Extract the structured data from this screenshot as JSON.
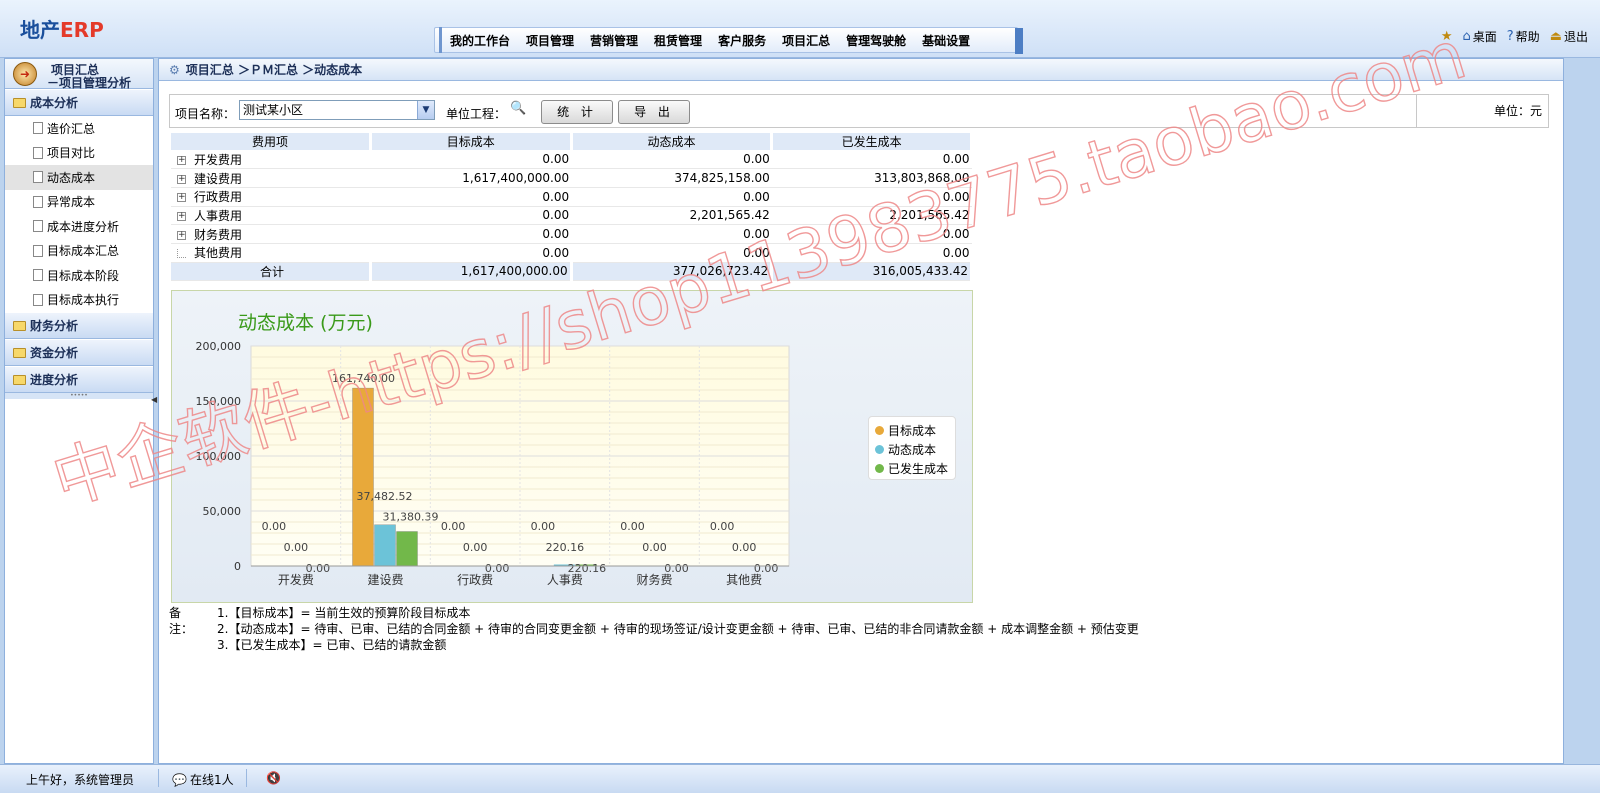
{
  "header": {
    "logo_a": "地产",
    "logo_b": "ERP",
    "nav": [
      "我的工作台",
      "项目管理",
      "营销管理",
      "租赁管理",
      "客户服务",
      "项目汇总",
      "管理驾驶舱",
      "基础设置"
    ],
    "tools": {
      "desktop": "桌面",
      "help": "帮助",
      "logout": "退出"
    }
  },
  "sidebar": {
    "title_1": "项目汇总",
    "title_2": "－项目管理分析",
    "groups": [
      {
        "label": "成本分析"
      },
      {
        "label": "财务分析"
      },
      {
        "label": "资金分析"
      },
      {
        "label": "进度分析"
      }
    ],
    "items": [
      "造价汇总",
      "项目对比",
      "动态成本",
      "异常成本",
      "成本进度分析",
      "目标成本汇总",
      "目标成本阶段",
      "目标成本执行"
    ],
    "active_item": "动态成本"
  },
  "breadcrumb": "项目汇总  ＞ＰＭ汇总  ＞动态成本",
  "toolbar": {
    "project_label": "项目名称：",
    "project_value": "测试某小区",
    "unit_project_label": "单位工程：",
    "stat_button": "统 计",
    "export_button": "导 出",
    "unit_label": "单位：元"
  },
  "table": {
    "headers": [
      "费用项",
      "目标成本",
      "动态成本",
      "已发生成本"
    ],
    "rows": [
      {
        "name": "开发费用",
        "target": "0.00",
        "dynamic": "0.00",
        "incurred": "0.00",
        "expandable": true
      },
      {
        "name": "建设费用",
        "target": "1,617,400,000.00",
        "dynamic": "374,825,158.00",
        "incurred": "313,803,868.00",
        "expandable": true
      },
      {
        "name": "行政费用",
        "target": "0.00",
        "dynamic": "0.00",
        "incurred": "0.00",
        "expandable": true
      },
      {
        "name": "人事费用",
        "target": "0.00",
        "dynamic": "2,201,565.42",
        "incurred": "2,201,565.42",
        "expandable": true
      },
      {
        "name": "财务费用",
        "target": "0.00",
        "dynamic": "0.00",
        "incurred": "0.00",
        "expandable": true
      },
      {
        "name": "其他费用",
        "target": "0.00",
        "dynamic": "0.00",
        "incurred": "0.00",
        "expandable": false
      }
    ],
    "total": {
      "name": "合计",
      "target": "1,617,400,000.00",
      "dynamic": "377,026,723.42",
      "incurred": "316,005,433.42"
    }
  },
  "chart_data": {
    "type": "bar",
    "title": "动态成本 (万元)",
    "categories": [
      "开发费",
      "建设费",
      "行政费",
      "人事费",
      "财务费",
      "其他费"
    ],
    "series": [
      {
        "name": "目标成本",
        "color": "#e8a93a",
        "values": [
          0,
          161740,
          0,
          0,
          0,
          0
        ],
        "labels": [
          "0.00",
          "161,740.00",
          "0.00",
          "0.00",
          "0.00",
          "0.00"
        ]
      },
      {
        "name": "动态成本",
        "color": "#6cc3d8",
        "values": [
          0,
          37482.52,
          0,
          220.16,
          0,
          0
        ],
        "labels": [
          "0.00",
          "37,482.52",
          "0.00",
          "220.16",
          "0.00",
          "0.00"
        ]
      },
      {
        "name": "已发生成本",
        "color": "#72b84a",
        "values": [
          0,
          31380.39,
          0,
          220.16,
          0,
          0
        ],
        "labels": [
          "0.00",
          "31,380.39",
          "0.00",
          "220.16",
          "0.00",
          "0.00"
        ]
      }
    ],
    "yticks": [
      "0",
      "50,000",
      "100,000",
      "150,000",
      "200,000"
    ],
    "ylim": [
      0,
      200000
    ],
    "legend": "right"
  },
  "notes": {
    "label": "备注：",
    "lines": [
      "1.【目标成本】= 当前生效的预算阶段目标成本",
      "2.【动态成本】= 待审、已审、已结的合同金额  +  待审的合同变更金额  +  待审的现场签证/设计变更金额  +  待审、已审、已结的非合同请款金额  +  成本调整金额  +  预估变更",
      "3.【已发生成本】= 已审、已结的请款金额"
    ]
  },
  "footer": {
    "greeting": "上午好，系统管理员",
    "online": "在线1人"
  },
  "watermark": "中企软件-https://shop113983775.taobao.com"
}
